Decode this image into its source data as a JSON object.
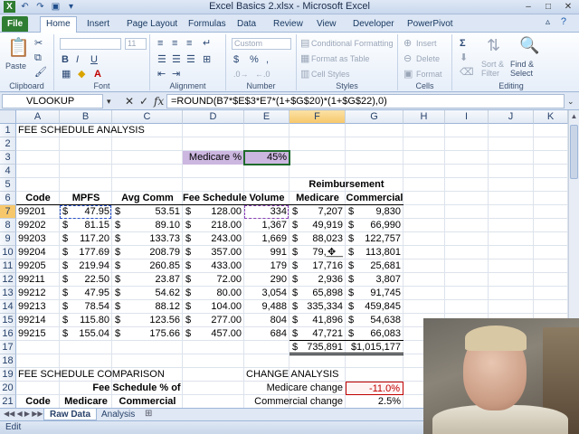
{
  "window": {
    "title": "Excel Basics 2.xlsx - Microsoft Excel"
  },
  "ribbon_tabs": [
    "File",
    "Home",
    "Insert",
    "Page Layout",
    "Formulas",
    "Data",
    "Review",
    "View",
    "Developer",
    "PowerPivot"
  ],
  "ribbon": {
    "clipboard": {
      "label": "Clipboard",
      "paste": "Paste"
    },
    "font": {
      "label": "Font",
      "size": "11"
    },
    "alignment": {
      "label": "Alignment"
    },
    "number": {
      "label": "Number",
      "format": "Custom"
    },
    "styles": {
      "label": "Styles",
      "conditional": "Conditional Formatting",
      "table": "Format as Table",
      "cell_styles": "Cell Styles"
    },
    "cells": {
      "label": "Cells",
      "insert": "Insert",
      "delete": "Delete",
      "format": "Format"
    },
    "editing": {
      "label": "Editing",
      "sort": "Sort &",
      "filter": "Filter",
      "find": "Find &",
      "select": "Select"
    }
  },
  "formula_bar": {
    "name_box": "VLOOKUP",
    "fx": "fx",
    "formula": "=ROUND(B7*$E$3*E7*(1+$G$20)*(1+$G$22),0)"
  },
  "columns": [
    "A",
    "B",
    "C",
    "D",
    "E",
    "F",
    "G",
    "H",
    "I",
    "J",
    "K"
  ],
  "rows": [
    "1",
    "2",
    "3",
    "4",
    "5",
    "6",
    "7",
    "8",
    "9",
    "10",
    "11",
    "12",
    "13",
    "14",
    "15",
    "16",
    "17",
    "18",
    "19",
    "20",
    "21"
  ],
  "sheet": {
    "title": "FEE SCHEDULE ANALYSIS",
    "medicare_pct_label": "Medicare %",
    "medicare_pct_value": "45%",
    "reimbursement_header": "Reimbursement",
    "headers": {
      "code": "Code",
      "mpfs": "MPFS",
      "avg_comm": "Avg Comm",
      "fee_schedule": "Fee Schedule",
      "volume": "Volume",
      "medicare": "Medicare",
      "commercial": "Commercial"
    },
    "dollar": "$",
    "data_rows": [
      {
        "code": "99201",
        "mpfs": "47.95",
        "avg": "53.51",
        "fee": "128.00",
        "vol": "334",
        "med": "7,207",
        "com": "9,830"
      },
      {
        "code": "99202",
        "mpfs": "81.15",
        "avg": "89.10",
        "fee": "218.00",
        "vol": "1,367",
        "med": "49,919",
        "com": "66,990"
      },
      {
        "code": "99203",
        "mpfs": "117.20",
        "avg": "133.73",
        "fee": "243.00",
        "vol": "1,669",
        "med": "88,023",
        "com": "122,757"
      },
      {
        "code": "99204",
        "mpfs": "177.69",
        "avg": "208.79",
        "fee": "357.00",
        "vol": "991",
        "med": "79,___",
        "com": "113,801"
      },
      {
        "code": "99205",
        "mpfs": "219.94",
        "avg": "260.85",
        "fee": "433.00",
        "vol": "179",
        "med": "17,716",
        "com": "25,681"
      },
      {
        "code": "99211",
        "mpfs": "22.50",
        "avg": "23.87",
        "fee": "72.00",
        "vol": "290",
        "med": "2,936",
        "com": "3,807"
      },
      {
        "code": "99212",
        "mpfs": "47.95",
        "avg": "54.62",
        "fee": "80.00",
        "vol": "3,054",
        "med": "65,898",
        "com": "91,745"
      },
      {
        "code": "99213",
        "mpfs": "78.54",
        "avg": "88.12",
        "fee": "104.00",
        "vol": "9,488",
        "med": "335,334",
        "com": "459,845"
      },
      {
        "code": "99214",
        "mpfs": "115.80",
        "avg": "123.56",
        "fee": "277.00",
        "vol": "804",
        "med": "41,896",
        "com": "54,638"
      },
      {
        "code": "99215",
        "mpfs": "155.04",
        "avg": "175.66",
        "fee": "457.00",
        "vol": "684",
        "med": "47,721",
        "com": "66,083"
      }
    ],
    "totals": {
      "med": "735,891",
      "com": "$1,015,177"
    },
    "comparison_title": "FEE SCHEDULE COMPARISON",
    "comparison_sub": "Fee Schedule % of",
    "row21": {
      "code": "Code",
      "medicare": "Medicare",
      "commercial": "Commercial"
    },
    "change_title": "CHANGE ANALYSIS",
    "medicare_change_label": "Medicare change",
    "medicare_change_value": "-11.0%",
    "commercial_change_label": "Commercial change",
    "commercial_change_value": "2.5%"
  },
  "sheet_tabs": [
    "Raw Data",
    "Analysis"
  ],
  "status": {
    "mode": "Edit"
  }
}
